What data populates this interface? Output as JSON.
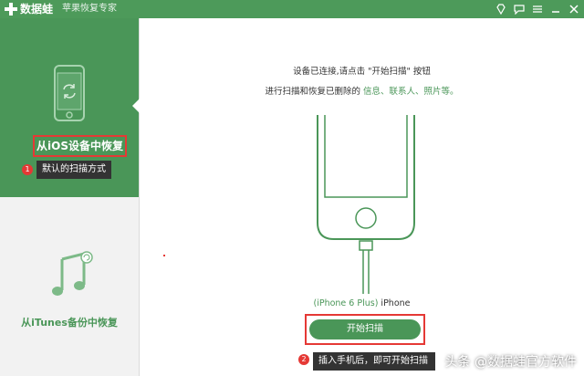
{
  "app": {
    "name": "数据蛙",
    "subtitle": "苹果恢复专家"
  },
  "window_icons": [
    "diamond-icon",
    "chat-icon",
    "menu-icon",
    "minimize-icon",
    "close-icon"
  ],
  "sidebar": {
    "items": [
      {
        "label": "从iOS设备中恢复",
        "icon": "phone-refresh-icon",
        "active": true
      },
      {
        "label": "从iTunes备份中恢复",
        "icon": "music-note-icon",
        "active": false
      }
    ],
    "tip": {
      "number": "1",
      "text": "默认的扫描方式"
    }
  },
  "main": {
    "instruction_line1": "设备已连接,请点击 \"开始扫描\" 按钮",
    "instruction_line2_prefix": "进行扫描和恢复已删除的",
    "instruction_highlights": " 信息、联系人、照片等。",
    "device_model": "(iPhone 6 Plus)",
    "device_name": " iPhone",
    "start_button": "开始扫描",
    "tip": {
      "number": "2",
      "text": "插入手机后，即可开始扫描"
    }
  },
  "watermark": "头条 @数据蛙官方软件",
  "colors": {
    "brand_green": "#4a9658",
    "titlebar_green": "#4d9a5a",
    "annotation_red": "#e53935",
    "tooltip_dark": "#333333"
  }
}
